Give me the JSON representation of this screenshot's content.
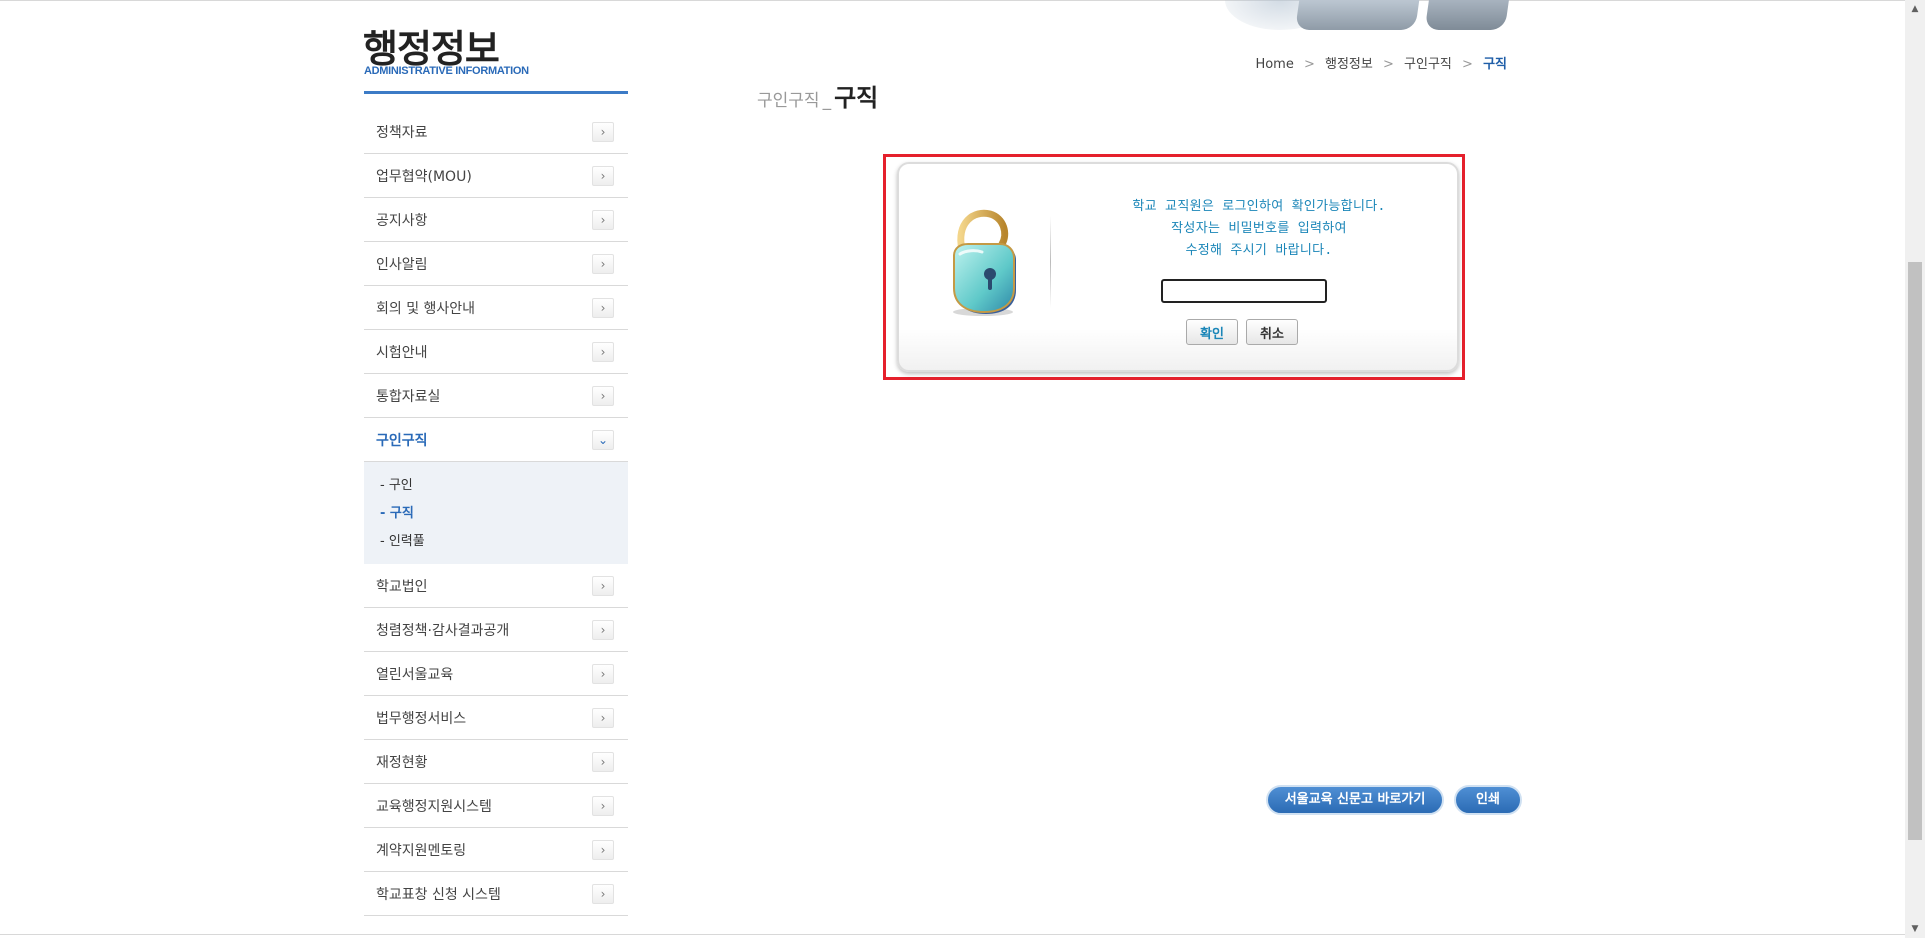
{
  "header": {
    "title": "행정정보",
    "subtitle": "ADMINISTRATIVE INFORMATION"
  },
  "breadcrumb": {
    "items": [
      "Home",
      "행정정보",
      "구인구직"
    ],
    "current": "구직"
  },
  "page_title": {
    "parent": "구인구직",
    "separator": "_",
    "current": "구직"
  },
  "sidebar": {
    "items": [
      {
        "label": "정책자료"
      },
      {
        "label": "업무협약(MOU)"
      },
      {
        "label": "공지사항"
      },
      {
        "label": "인사알림"
      },
      {
        "label": "회의 및 행사안내"
      },
      {
        "label": "시험안내"
      },
      {
        "label": "통합자료실"
      },
      {
        "label": "구인구직",
        "expanded": true
      },
      {
        "label": "학교법인"
      },
      {
        "label": "청렴정책·감사결과공개"
      },
      {
        "label": "열린서울교육"
      },
      {
        "label": "법무행정서비스"
      },
      {
        "label": "재정현황"
      },
      {
        "label": "교육행정지원시스템"
      },
      {
        "label": "계약지원멘토링"
      },
      {
        "label": "학교표창 신청 시스템"
      }
    ],
    "sub_items": [
      {
        "label": "- 구인"
      },
      {
        "label": "- 구직",
        "selected": true
      },
      {
        "label": "- 인력풀"
      }
    ],
    "arrow_icon": "chevron-right-icon",
    "expanded_icon": "chevron-down-icon"
  },
  "dialog": {
    "message_line1": "학교 교직원은 로그인하여 확인가능합니다.",
    "message_line2": "작성자는 비밀번호를 입력하여",
    "message_line3": "수정해 주시기 바랍니다.",
    "password_value": "",
    "ok_label": "확인",
    "cancel_label": "취소",
    "icon": "unlocked-padlock-icon"
  },
  "footer_buttons": {
    "sinmungo_label": "서울교육 신문고 바로가기",
    "print_label": "인쇄"
  },
  "colors": {
    "accent": "#2a6ab8",
    "highlight": "#e5202c",
    "message": "#1b86b8"
  }
}
